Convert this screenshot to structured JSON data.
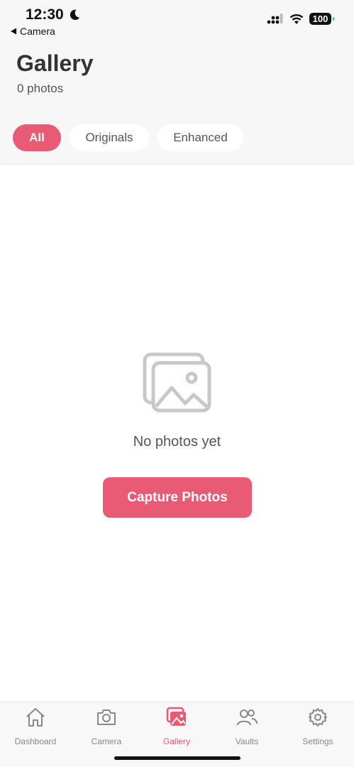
{
  "status_bar": {
    "time": "12:30",
    "back_label": "Camera",
    "battery": "100"
  },
  "header": {
    "title": "Gallery",
    "subtitle": "0 photos"
  },
  "filters": [
    {
      "label": "All",
      "active": true
    },
    {
      "label": "Originals",
      "active": false
    },
    {
      "label": "Enhanced",
      "active": false
    }
  ],
  "empty_state": {
    "icon": "photos-icon",
    "message": "No photos yet",
    "button_label": "Capture Photos"
  },
  "tab_bar": [
    {
      "label": "Dashboard",
      "icon": "home-icon",
      "active": false
    },
    {
      "label": "Camera",
      "icon": "camera-icon",
      "active": false
    },
    {
      "label": "Gallery",
      "icon": "gallery-icon",
      "active": true
    },
    {
      "label": "Vaults",
      "icon": "people-icon",
      "active": false
    },
    {
      "label": "Settings",
      "icon": "gear-icon",
      "active": false
    }
  ],
  "colors": {
    "accent": "#e95a75",
    "header_bg": "#f7f7f7",
    "muted_icon": "#c8c8c8"
  }
}
